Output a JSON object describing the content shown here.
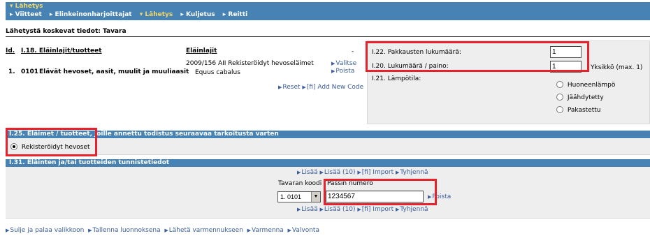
{
  "header": {
    "title": "▾ Lähetys",
    "nav": [
      {
        "label": "▸ Viitteet",
        "active": false
      },
      {
        "label": "▸ Elinkeinonharjoittajat",
        "active": false
      },
      {
        "label": "▾ Lähetys",
        "active": true
      },
      {
        "label": "▸ Kuljetus",
        "active": false
      },
      {
        "label": "▸ Reitti",
        "active": false
      }
    ]
  },
  "section_title": "Lähetystä koskevat tiedot: Tavara",
  "goods": {
    "col_id": "Id.",
    "col_title": "I.18. Eläinlajit/tuotteet",
    "col_species": "Eläinlajit",
    "dash": "-",
    "row_number": "1.",
    "row_code": "0101",
    "row_desc": "Elävät hevoset, aasit, muulit ja muuliaasit",
    "species_name": "2009/156 AII Rekisteröidyt hevoseläimet",
    "species_latin": "Equus cabalus",
    "link_select": "Valitse",
    "link_remove": "Poista",
    "link_reset": "Reset",
    "link_add_code": "[fi] Add New Code"
  },
  "right_panel": {
    "label_packages": "I.22. Pakkausten lukumäärä:",
    "value_packages": "1",
    "label_quantity": "I.20. Lukumäärä / paino:",
    "value_quantity": "1",
    "unit_text": "Yksikkö  (max. 1)",
    "label_temp": "I.21. Lämpötila:",
    "temp_options": [
      "Huoneenlämpö",
      "Jäähdytetty",
      "Pakastettu"
    ]
  },
  "purpose": {
    "bar_label": "I.25. Eläimet / tuotteet, joille annettu todistus seuraavaa tarkoitusta varten",
    "option_label": "Rekisteröidyt hevoset"
  },
  "identification": {
    "bar_label": "I.31. Eläinten ja/tai tuotteiden tunnistetiedot",
    "links": [
      "Lisää",
      "Lisää (10)",
      "[fi] Import",
      "Tyhjennä"
    ],
    "col_code": "Tavaran koodi",
    "col_passport": "Passin numero",
    "code_select": "1. 0101",
    "passport_value": "1234567",
    "remove_link": "Poista"
  },
  "footer_links": [
    "Sulje ja palaa valikkoon",
    "Tallenna luonnoksena",
    "Lähetä varmennukseen",
    "Varmenna",
    "Valvonta"
  ]
}
